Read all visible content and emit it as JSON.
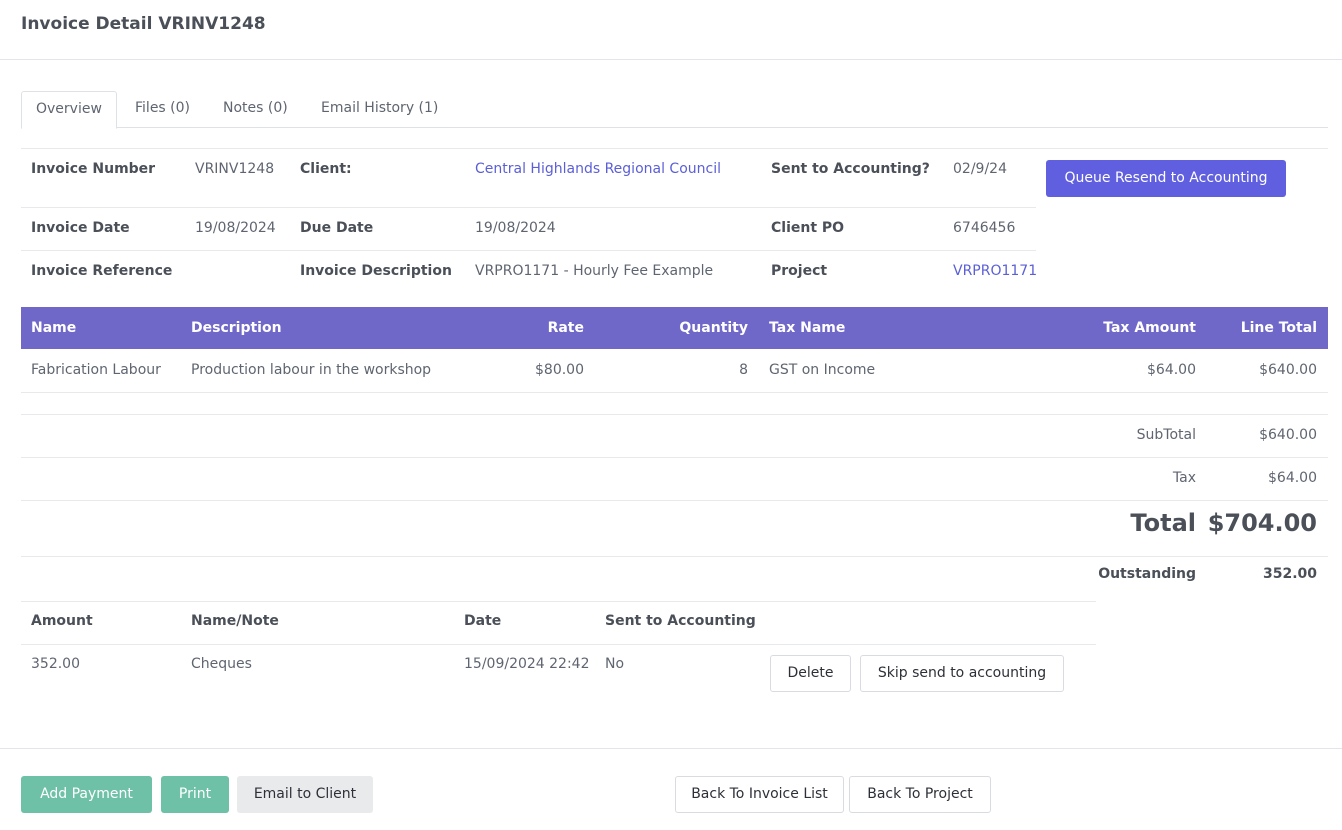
{
  "page": {
    "title": "Invoice Detail VRINV1248"
  },
  "tabs": [
    {
      "label": "Overview"
    },
    {
      "label": "Files (0)"
    },
    {
      "label": "Notes (0)"
    },
    {
      "label": "Email History (1)"
    }
  ],
  "invoice": {
    "number_label": "Invoice Number",
    "number": "VRINV1248",
    "client_label": "Client:",
    "client": "Central Highlands Regional Council",
    "sent_label": "Sent to Accounting?",
    "sent": "02/9/24",
    "date_label": "Invoice Date",
    "date": "19/08/2024",
    "due_label": "Due Date",
    "due": "19/08/2024",
    "po_label": "Client PO",
    "po": "6746456",
    "ref_label": "Invoice Reference",
    "ref": "",
    "desc_label": "Invoice Description",
    "desc": "VRPRO1171 - Hourly Fee Example",
    "project_label": "Project",
    "project": "VRPRO1171",
    "resend_button": "Queue Resend to Accounting"
  },
  "lines_table": {
    "headers": [
      "Name",
      "Description",
      "Rate",
      "Quantity",
      "Tax Name",
      "Tax Amount",
      "Line Total"
    ],
    "rows": [
      [
        "Fabrication Labour",
        "Production labour in the workshop",
        "$80.00",
        "8",
        "GST on Income",
        "$64.00",
        "$640.00"
      ]
    ]
  },
  "totals": {
    "subtotal_label": "SubTotal",
    "subtotal": "$640.00",
    "tax_label": "Tax",
    "tax": "$64.00",
    "total_label": "Total",
    "total": "$704.00",
    "outstanding_label": "Outstanding",
    "outstanding": "352.00"
  },
  "payments": {
    "headers": [
      "Amount",
      "Name/Note",
      "Date",
      "Sent to Accounting"
    ],
    "rows": [
      {
        "amount": "352.00",
        "note": "Cheques",
        "date": "15/09/2024 22:42",
        "sent": "No",
        "delete_label": "Delete",
        "skip_label": "Skip send to accounting"
      }
    ]
  },
  "footer": {
    "add_payment": "Add Payment",
    "print": "Print",
    "email_client": "Email to Client",
    "back_invoice_list": "Back To Invoice List",
    "back_project": "Back To Project"
  },
  "colors": {
    "primary": "#5f5fe0",
    "table_header": "#7068c9",
    "success": "#6ec1a6",
    "link": "#5b5fd6"
  }
}
